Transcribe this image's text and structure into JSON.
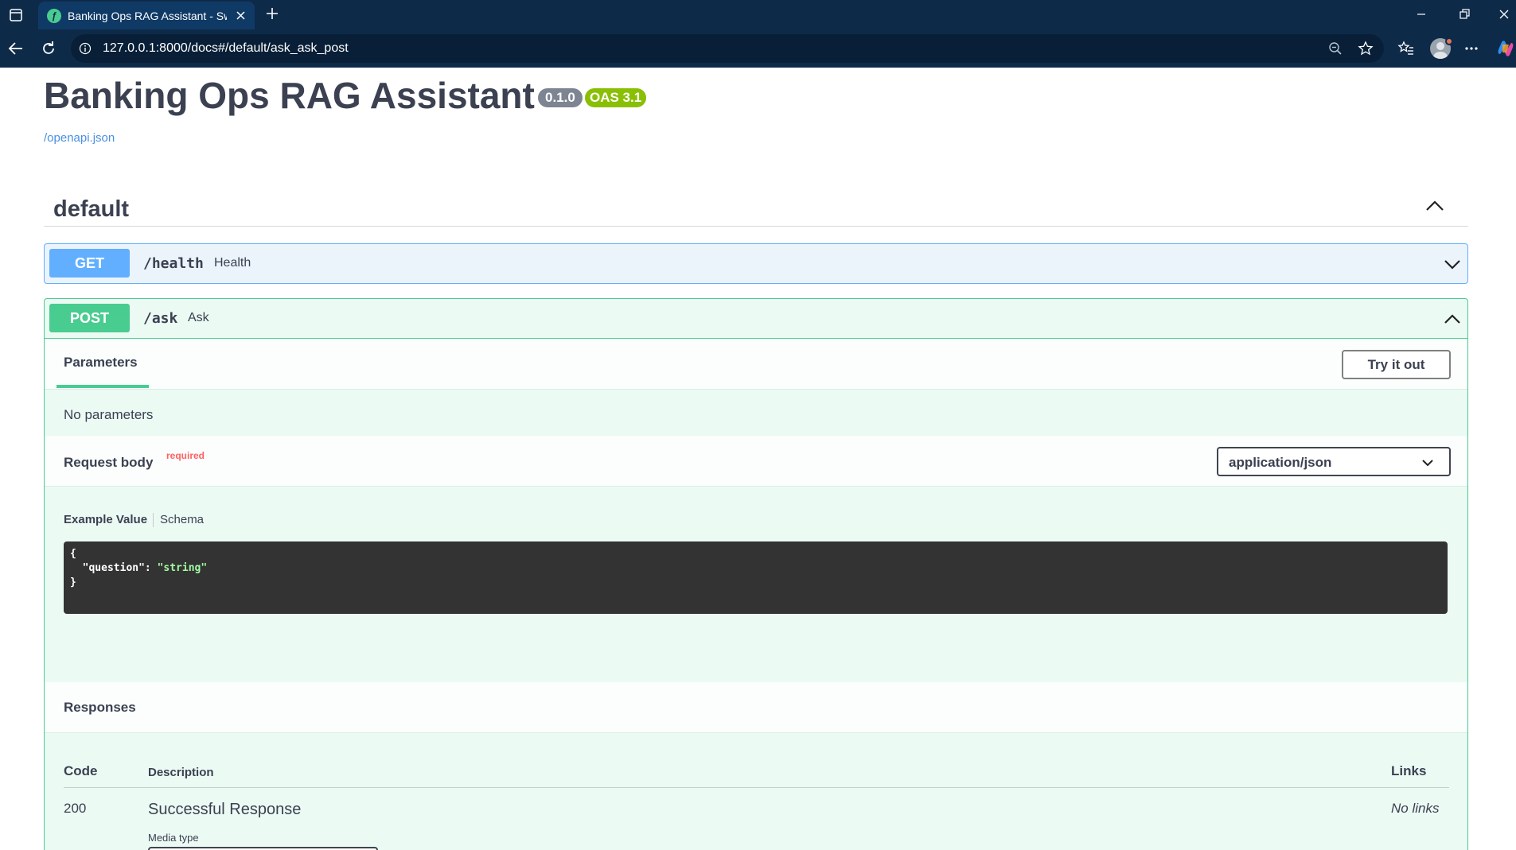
{
  "browser": {
    "tab_title": "Banking Ops RAG Assistant - Swa",
    "url": "127.0.0.1:8000/docs#/default/ask_ask_post"
  },
  "info": {
    "title": "Banking Ops RAG Assistant",
    "version": "0.1.0",
    "oas": "OAS 3.1",
    "spec_link": "/openapi.json"
  },
  "tag": {
    "name": "default"
  },
  "operations": {
    "get_health": {
      "method": "GET",
      "path": "/health",
      "summary": "Health"
    },
    "post_ask": {
      "method": "POST",
      "path": "/ask",
      "summary": "Ask"
    }
  },
  "parameters": {
    "tab_label": "Parameters",
    "try_button": "Try it out",
    "empty_text": "No parameters"
  },
  "request_body": {
    "title": "Request body",
    "required_label": "required",
    "content_type": "application/json",
    "example_tab": "Example Value",
    "schema_tab": "Schema",
    "code": {
      "open": "{",
      "key": "  \"question\": ",
      "value": "\"string\"",
      "close": "}"
    }
  },
  "responses": {
    "title": "Responses",
    "col_code": "Code",
    "col_description": "Description",
    "col_links": "Links",
    "rows": [
      {
        "code": "200",
        "description": "Successful Response",
        "links": "No links",
        "media_type_label": "Media type"
      }
    ]
  },
  "colors": {
    "get": "#61affe",
    "post": "#49cc90",
    "browser_frame": "#0e2a49"
  }
}
